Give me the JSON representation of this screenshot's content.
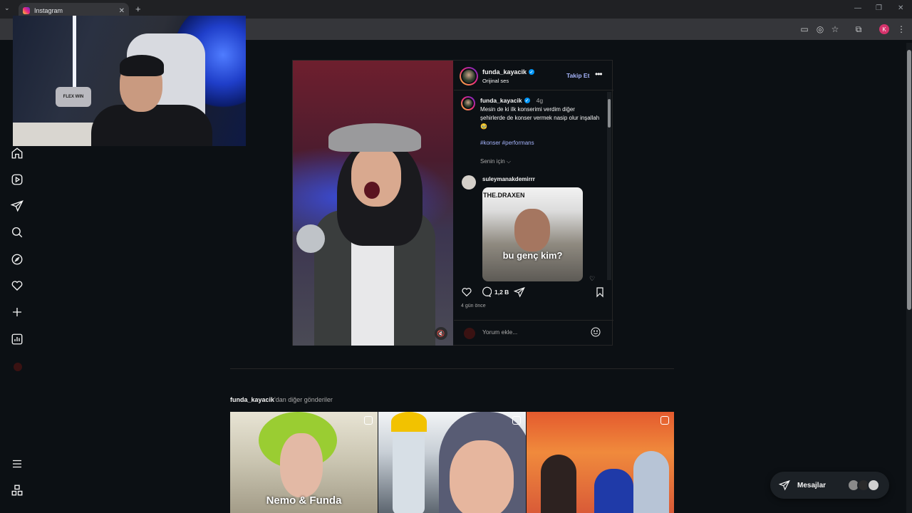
{
  "browser": {
    "tab_title": "Instagram",
    "tab_close": "✕",
    "new_tab": "+",
    "profile_initial": "K",
    "window_controls": [
      "—",
      "❐",
      "✕"
    ]
  },
  "webcam": {
    "pillow_text": "FLEX WIN"
  },
  "nav": {
    "icons": [
      "home-icon",
      "reels-icon",
      "direct-icon",
      "search-icon",
      "explore-icon",
      "heart-icon",
      "create-icon",
      "insights-icon",
      "profile-avatar",
      "menu-icon",
      "apps-icon"
    ]
  },
  "post": {
    "username": "funda_kayacik",
    "audio": "Orijinal ses",
    "follow": "Takip Et",
    "caption_user": "funda_kayacik",
    "caption_time": "4g",
    "caption": "Mesin de ki ilk konserimi verdim diğer şehirlerde de konser vermek nasip olur inşallah 🥹",
    "hashtags": "#konser #performans",
    "for_you": "Senin için ⌵",
    "comment_user": "suleymanakdemirrr",
    "gif_title": "THE.DRAXEN",
    "gif_caption": "bu genç kim?",
    "comment_count": "1,2 B",
    "posted_ago": "4 gün önce",
    "add_comment_placeholder": "Yorum ekle..."
  },
  "more_posts": {
    "username": "funda_kayacik",
    "suffix": "'dan diğer gönderiler",
    "thumb1_caption": "Nemo & Funda"
  },
  "messages": {
    "label": "Mesajlar"
  },
  "colors": {
    "background": "#0c1014",
    "link_accent": "#a5b4fc",
    "verified_blue": "#0095f6"
  }
}
